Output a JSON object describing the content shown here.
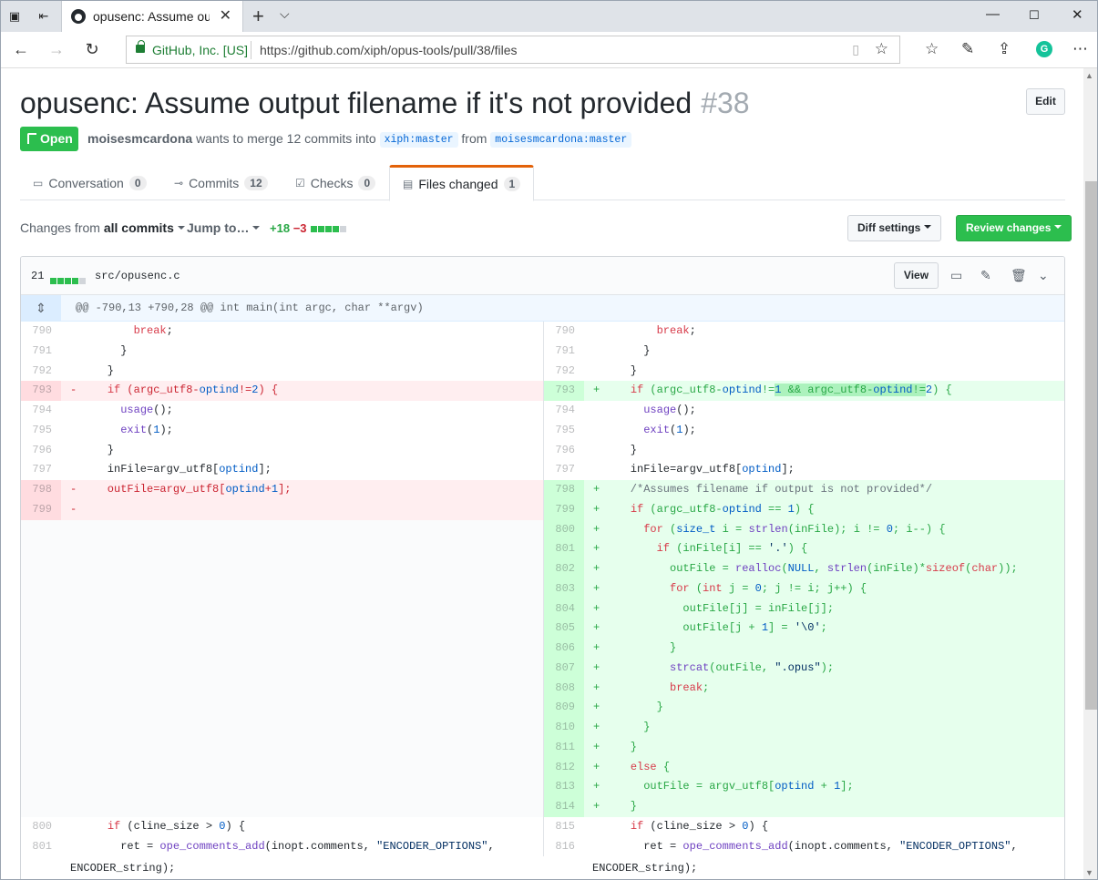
{
  "browser": {
    "tab_title": "opusenc: Assume output",
    "cert_label": "GitHub, Inc. [US]",
    "url": "https://github.com/xiph/opus-tools/pull/38/files"
  },
  "pr": {
    "title": "opusenc: Assume output filename if it's not provided",
    "number": "#38",
    "edit_label": "Edit",
    "state": "Open",
    "author": "moisesmcardona",
    "merge_text": "wants to merge 12 commits into",
    "base_ref": "xiph:master",
    "from_text": "from",
    "head_ref": "moisesmcardona:master"
  },
  "tabs": [
    {
      "label": "Conversation",
      "count": "0"
    },
    {
      "label": "Commits",
      "count": "12"
    },
    {
      "label": "Checks",
      "count": "0"
    },
    {
      "label": "Files changed",
      "count": "1"
    }
  ],
  "toolbar": {
    "changes_from": "Changes from",
    "all_commits": "all commits",
    "jump_to": "Jump to…",
    "additions": "+18",
    "deletions": "−3",
    "diff_settings": "Diff settings",
    "review_changes": "Review changes"
  },
  "file": {
    "changes": "21",
    "name": "src/opusenc.c",
    "view_label": "View",
    "hunk_header": "@@ -790,13 +790,28 @@ int main(int argc, char **argv)",
    "wrap_tail": "ENCODER_string);"
  },
  "colors": {
    "added": "#e6ffed",
    "deleted": "#ffeef0",
    "primary": "#2cbe4e",
    "tab_accent": "#e36209"
  },
  "diff_left": [
    {
      "ln": "790",
      "t": "ctx",
      "code": "        break;"
    },
    {
      "ln": "791",
      "t": "ctx",
      "code": "      }"
    },
    {
      "ln": "792",
      "t": "ctx",
      "code": "    }"
    },
    {
      "ln": "793",
      "t": "del",
      "code": "    if (argc_utf8-optind!=2) {"
    },
    {
      "ln": "794",
      "t": "ctx",
      "code": "      usage();"
    },
    {
      "ln": "795",
      "t": "ctx",
      "code": "      exit(1);"
    },
    {
      "ln": "796",
      "t": "ctx",
      "code": "    }"
    },
    {
      "ln": "797",
      "t": "ctx",
      "code": "    inFile=argv_utf8[optind];"
    },
    {
      "ln": "798",
      "t": "del",
      "code": "    outFile=argv_utf8[optind+1];"
    },
    {
      "ln": "799",
      "t": "del",
      "code": ""
    },
    {
      "ln": "",
      "t": "empty",
      "code": ""
    },
    {
      "ln": "",
      "t": "empty",
      "code": ""
    },
    {
      "ln": "",
      "t": "empty",
      "code": ""
    },
    {
      "ln": "",
      "t": "empty",
      "code": ""
    },
    {
      "ln": "",
      "t": "empty",
      "code": ""
    },
    {
      "ln": "",
      "t": "empty",
      "code": ""
    },
    {
      "ln": "",
      "t": "empty",
      "code": ""
    },
    {
      "ln": "",
      "t": "empty",
      "code": ""
    },
    {
      "ln": "",
      "t": "empty",
      "code": ""
    },
    {
      "ln": "",
      "t": "empty",
      "code": ""
    },
    {
      "ln": "",
      "t": "empty",
      "code": ""
    },
    {
      "ln": "",
      "t": "empty",
      "code": ""
    },
    {
      "ln": "",
      "t": "empty",
      "code": ""
    },
    {
      "ln": "",
      "t": "empty",
      "code": ""
    },
    {
      "ln": "",
      "t": "empty",
      "code": ""
    },
    {
      "ln": "800",
      "t": "ctx",
      "code": "    if (cline_size > 0) {"
    },
    {
      "ln": "801",
      "t": "ctx",
      "code": "      ret = ope_comments_add(inopt.comments, \"ENCODER_OPTIONS\","
    }
  ],
  "diff_right": [
    {
      "ln": "790",
      "t": "ctx",
      "code": "        break;"
    },
    {
      "ln": "791",
      "t": "ctx",
      "code": "      }"
    },
    {
      "ln": "792",
      "t": "ctx",
      "code": "    }"
    },
    {
      "ln": "793",
      "t": "add",
      "code": "    if (argc_utf8-optind!=1 && argc_utf8-optind!=2) {"
    },
    {
      "ln": "794",
      "t": "ctx",
      "code": "      usage();"
    },
    {
      "ln": "795",
      "t": "ctx",
      "code": "      exit(1);"
    },
    {
      "ln": "796",
      "t": "ctx",
      "code": "    }"
    },
    {
      "ln": "797",
      "t": "ctx",
      "code": "    inFile=argv_utf8[optind];"
    },
    {
      "ln": "798",
      "t": "add",
      "code": "    /*Assumes filename if output is not provided*/"
    },
    {
      "ln": "799",
      "t": "add",
      "code": "    if (argc_utf8-optind == 1) {"
    },
    {
      "ln": "800",
      "t": "add",
      "code": "      for (size_t i = strlen(inFile); i != 0; i--) {"
    },
    {
      "ln": "801",
      "t": "add",
      "code": "        if (inFile[i] == '.') {"
    },
    {
      "ln": "802",
      "t": "add",
      "code": "          outFile = realloc(NULL, strlen(inFile)*sizeof(char));"
    },
    {
      "ln": "803",
      "t": "add",
      "code": "          for (int j = 0; j != i; j++) {"
    },
    {
      "ln": "804",
      "t": "add",
      "code": "            outFile[j] = inFile[j];"
    },
    {
      "ln": "805",
      "t": "add",
      "code": "            outFile[j + 1] = '\\0';"
    },
    {
      "ln": "806",
      "t": "add",
      "code": "          }"
    },
    {
      "ln": "807",
      "t": "add",
      "code": "          strcat(outFile, \".opus\");"
    },
    {
      "ln": "808",
      "t": "add",
      "code": "          break;"
    },
    {
      "ln": "809",
      "t": "add",
      "code": "        }"
    },
    {
      "ln": "810",
      "t": "add",
      "code": "      }"
    },
    {
      "ln": "811",
      "t": "add",
      "code": "    }"
    },
    {
      "ln": "812",
      "t": "add",
      "code": "    else {"
    },
    {
      "ln": "813",
      "t": "add",
      "code": "      outFile = argv_utf8[optind + 1];"
    },
    {
      "ln": "814",
      "t": "add",
      "code": "    }"
    },
    {
      "ln": "815",
      "t": "ctx",
      "code": "    if (cline_size > 0) {"
    },
    {
      "ln": "816",
      "t": "ctx",
      "code": "      ret = ope_comments_add(inopt.comments, \"ENCODER_OPTIONS\","
    }
  ]
}
